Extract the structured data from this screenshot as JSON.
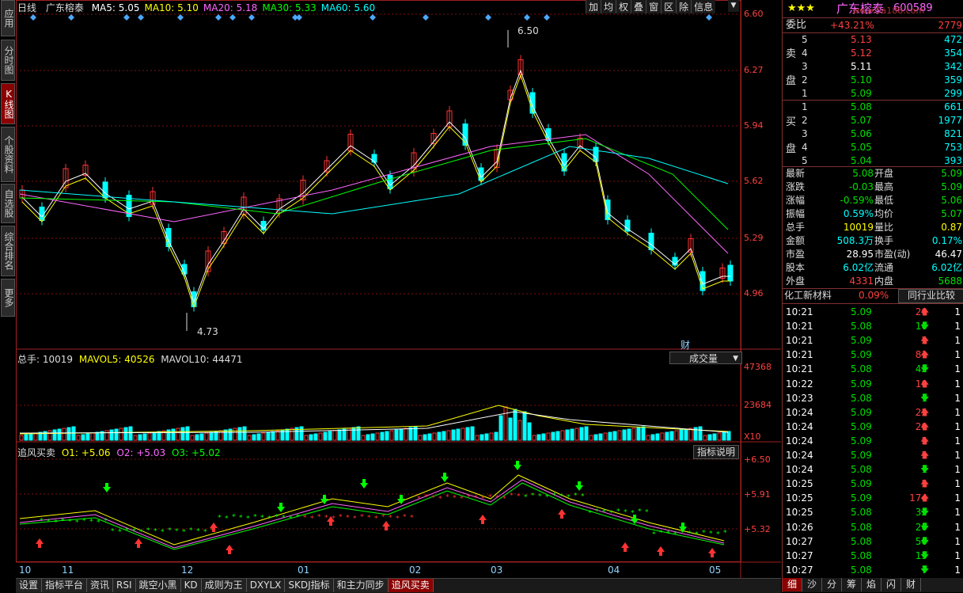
{
  "nav": [
    {
      "label": "应用",
      "active": false
    },
    {
      "label": "分时图",
      "active": false
    },
    {
      "label": "K线图",
      "active": true
    },
    {
      "label": "个股资料",
      "active": false
    },
    {
      "label": "自选股",
      "active": false
    },
    {
      "label": "综合排名",
      "active": false
    },
    {
      "label": "更多",
      "active": false
    }
  ],
  "header": {
    "period": "日线",
    "stock": "广东榕泰",
    "ma": [
      {
        "label": "MA5: 5.05",
        "color": "#ffffff"
      },
      {
        "label": "MA10: 5.10",
        "color": "#ffff00"
      },
      {
        "label": "MA20: 5.18",
        "color": "#ff66ff"
      },
      {
        "label": "MA30: 5.33",
        "color": "#00ff00"
      },
      {
        "label": "MA60: 5.60",
        "color": "#00ffff"
      }
    ]
  },
  "toolbar": [
    "加",
    "均",
    "权",
    "叠",
    "窗",
    "区",
    "除",
    "信息"
  ],
  "price_axis": [
    "6.60",
    "6.27",
    "5.94",
    "5.62",
    "5.29",
    "4.96"
  ],
  "price_annotations": {
    "high": "6.50",
    "low": "4.73",
    "cai": "财"
  },
  "volume_header": {
    "zongshou": "总手: 10019",
    "mavol5": "MAVOL5: 40526",
    "mavol10": "MAVOL10: 44471",
    "selector": "成交量"
  },
  "volume_axis": [
    "47368",
    "23684",
    "X10"
  ],
  "indicator_header": {
    "name": "追风买卖",
    "o1": "O1: +5.06",
    "o2": "O2: +5.03",
    "o3": "O3: +5.02",
    "explain": "指标说明"
  },
  "indicator_axis": [
    "+6.50",
    "+5.91",
    "+5.32"
  ],
  "x_axis": [
    "10",
    "11",
    "12",
    "01",
    "02",
    "03",
    "04",
    "05"
  ],
  "bottom_tabs": [
    {
      "label": "设置",
      "active": false
    },
    {
      "label": "指标平台",
      "active": false
    },
    {
      "label": "资讯",
      "active": false
    },
    {
      "label": "RSI",
      "active": false
    },
    {
      "label": "跳空小黑",
      "active": false
    },
    {
      "label": "KD",
      "active": false
    },
    {
      "label": "成则为王",
      "active": false
    },
    {
      "label": "DXYLX",
      "active": false
    },
    {
      "label": "SKDJ指标",
      "active": false
    },
    {
      "label": "和主力同步",
      "active": false
    },
    {
      "label": "追风买卖",
      "active": true
    }
  ],
  "quote": {
    "stars": "★★★",
    "name": "广东榕泰",
    "code": "600589",
    "watermark": "www.5a188.com",
    "weibi_label": "委比",
    "weibi": "+43.21%",
    "weicha": "2779",
    "sell_label": [
      "卖",
      "盘"
    ],
    "buy_label": [
      "买",
      "盘"
    ],
    "sell": [
      {
        "lv": "5",
        "p": "5.13",
        "v": "472",
        "pc": "r"
      },
      {
        "lv": "4",
        "p": "5.12",
        "v": "354",
        "pc": "r"
      },
      {
        "lv": "3",
        "p": "5.11",
        "v": "342",
        "pc": "w"
      },
      {
        "lv": "2",
        "p": "5.10",
        "v": "359",
        "pc": "g"
      },
      {
        "lv": "1",
        "p": "5.09",
        "v": "299",
        "pc": "g"
      }
    ],
    "buy": [
      {
        "lv": "1",
        "p": "5.08",
        "v": "661",
        "pc": "g"
      },
      {
        "lv": "2",
        "p": "5.07",
        "v": "1977",
        "pc": "g"
      },
      {
        "lv": "3",
        "p": "5.06",
        "v": "821",
        "pc": "g"
      },
      {
        "lv": "4",
        "p": "5.05",
        "v": "753",
        "pc": "g"
      },
      {
        "lv": "5",
        "p": "5.04",
        "v": "393",
        "pc": "g"
      }
    ],
    "stats": [
      [
        "最新",
        "5.08",
        "g",
        "开盘",
        "5.09",
        "g"
      ],
      [
        "涨跌",
        "-0.03",
        "g",
        "最高",
        "5.09",
        "g"
      ],
      [
        "涨幅",
        "-0.59%",
        "g",
        "最低",
        "5.06",
        "g"
      ],
      [
        "振幅",
        "0.59%",
        "c",
        "均价",
        "5.07",
        "g"
      ],
      [
        "总手",
        "10019",
        "y",
        "量比",
        "0.87",
        "y"
      ],
      [
        "金额",
        "508.3万",
        "c",
        "换手",
        "0.17%",
        "c"
      ],
      [
        "市盈",
        "28.95",
        "w",
        "市盈(动)",
        "46.47",
        "w"
      ],
      [
        "股本",
        "6.02亿",
        "c",
        "流通",
        "6.02亿",
        "c"
      ],
      [
        "外盘",
        "4331",
        "r",
        "内盘",
        "5688",
        "g"
      ]
    ],
    "industry": "化工新材料",
    "industry_pct": "0.09%",
    "compare": "同行业比较",
    "ticks": [
      [
        "10:21",
        "5.09",
        "20",
        "up"
      ],
      [
        "10:21",
        "5.08",
        "10",
        "down"
      ],
      [
        "10:21",
        "5.09",
        "5",
        "up"
      ],
      [
        "10:21",
        "5.09",
        "81",
        "up"
      ],
      [
        "10:21",
        "5.08",
        "42",
        "down"
      ],
      [
        "10:22",
        "5.09",
        "10",
        "up"
      ],
      [
        "10:23",
        "5.08",
        "1",
        "down"
      ],
      [
        "10:24",
        "5.09",
        "25",
        "up"
      ],
      [
        "10:24",
        "5.09",
        "20",
        "up"
      ],
      [
        "10:24",
        "5.09",
        "5",
        "up"
      ],
      [
        "10:24",
        "5.09",
        "5",
        "up"
      ],
      [
        "10:24",
        "5.08",
        "1",
        "down"
      ],
      [
        "10:25",
        "5.09",
        "5",
        "up"
      ],
      [
        "10:25",
        "5.09",
        "174",
        "up"
      ],
      [
        "10:25",
        "5.08",
        "32",
        "down"
      ],
      [
        "10:26",
        "5.08",
        "20",
        "down"
      ],
      [
        "10:27",
        "5.08",
        "50",
        "down"
      ],
      [
        "10:27",
        "5.08",
        "15",
        "down"
      ],
      [
        "10:27",
        "5.08",
        "7",
        "down"
      ]
    ],
    "tick_tail": "1",
    "right_tabs": [
      {
        "label": "细",
        "active": true
      },
      {
        "label": "沙",
        "active": false
      },
      {
        "label": "分",
        "active": false
      },
      {
        "label": "筹",
        "active": false
      },
      {
        "label": "焰",
        "active": false
      },
      {
        "label": "闪",
        "active": false
      },
      {
        "label": "财",
        "active": false
      }
    ]
  }
}
